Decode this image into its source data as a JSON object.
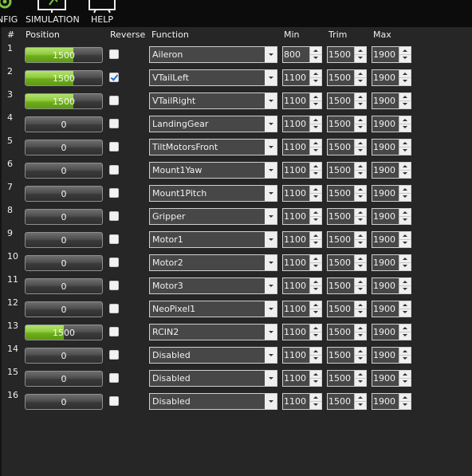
{
  "toolbar": {
    "items": [
      {
        "label": "NFIG",
        "icon": "config-icon"
      },
      {
        "label": "SIMULATION",
        "icon": "monitor-icon"
      },
      {
        "label": "HELP",
        "icon": "monitor-icon"
      }
    ]
  },
  "table": {
    "headers": {
      "num": "#",
      "position": "Position",
      "reverse": "Reverse",
      "function": "Function",
      "min": "Min",
      "trim": "Trim",
      "max": "Max"
    },
    "rows": [
      {
        "num": "1",
        "value": "1500",
        "fill": 0.62,
        "reversed": false,
        "function": "Aileron",
        "min": "800",
        "trim": "1500",
        "max": "1900"
      },
      {
        "num": "2",
        "value": "1500",
        "fill": 0.62,
        "reversed": true,
        "function": "VTailLeft",
        "min": "1100",
        "trim": "1500",
        "max": "1900"
      },
      {
        "num": "3",
        "value": "1500",
        "fill": 0.62,
        "reversed": false,
        "function": "VTailRight",
        "min": "1100",
        "trim": "1500",
        "max": "1900"
      },
      {
        "num": "4",
        "value": "0",
        "fill": 0,
        "reversed": false,
        "function": "LandingGear",
        "min": "1100",
        "trim": "1500",
        "max": "1900"
      },
      {
        "num": "5",
        "value": "0",
        "fill": 0,
        "reversed": false,
        "function": "TiltMotorsFront",
        "min": "1100",
        "trim": "1500",
        "max": "1900"
      },
      {
        "num": "6",
        "value": "0",
        "fill": 0,
        "reversed": false,
        "function": "Mount1Yaw",
        "min": "1100",
        "trim": "1500",
        "max": "1900"
      },
      {
        "num": "7",
        "value": "0",
        "fill": 0,
        "reversed": false,
        "function": "Mount1Pitch",
        "min": "1100",
        "trim": "1500",
        "max": "1900"
      },
      {
        "num": "8",
        "value": "0",
        "fill": 0,
        "reversed": false,
        "function": "Gripper",
        "min": "1100",
        "trim": "1500",
        "max": "1900"
      },
      {
        "num": "9",
        "value": "0",
        "fill": 0,
        "reversed": false,
        "function": "Motor1",
        "min": "1100",
        "trim": "1500",
        "max": "1900"
      },
      {
        "num": "10",
        "value": "0",
        "fill": 0,
        "reversed": false,
        "function": "Motor2",
        "min": "1100",
        "trim": "1500",
        "max": "1900"
      },
      {
        "num": "11",
        "value": "0",
        "fill": 0,
        "reversed": false,
        "function": "Motor3",
        "min": "1100",
        "trim": "1500",
        "max": "1900"
      },
      {
        "num": "12",
        "value": "0",
        "fill": 0,
        "reversed": false,
        "function": "NeoPixel1",
        "min": "1100",
        "trim": "1500",
        "max": "1900"
      },
      {
        "num": "13",
        "value": "1500",
        "fill": 0.5,
        "reversed": false,
        "function": "RCIN2",
        "min": "1100",
        "trim": "1500",
        "max": "1900"
      },
      {
        "num": "14",
        "value": "0",
        "fill": 0,
        "reversed": false,
        "function": "Disabled",
        "min": "1100",
        "trim": "1500",
        "max": "1900"
      },
      {
        "num": "15",
        "value": "0",
        "fill": 0,
        "reversed": false,
        "function": "Disabled",
        "min": "1100",
        "trim": "1500",
        "max": "1900"
      },
      {
        "num": "16",
        "value": "0",
        "fill": 0,
        "reversed": false,
        "function": "Disabled",
        "min": "1100",
        "trim": "1500",
        "max": "1900"
      }
    ]
  },
  "colors": {
    "background": "#262626",
    "bar_green": "#8fca3e",
    "check_blue": "#1e6fd9"
  }
}
